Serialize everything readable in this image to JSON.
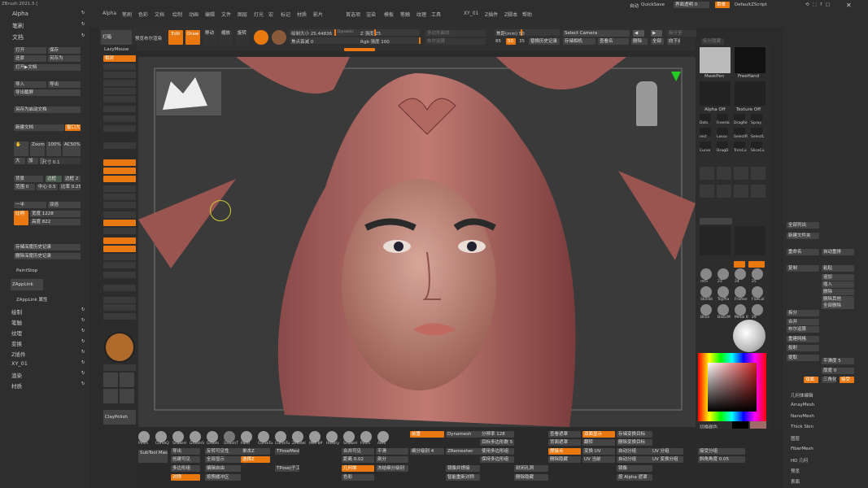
{
  "app": {
    "title": "ZBrush 2021.5 ["
  },
  "menu": [
    "Alpha",
    "笔刷",
    "色彩",
    "文档",
    "绘制",
    "动画",
    "编辑",
    "文件",
    "图层",
    "灯光",
    "宏",
    "标记",
    "材质",
    "影片",
    "首选项",
    "渲染",
    "模板",
    "笔触",
    "纹理",
    "工具",
    "XY_01",
    "Z插件",
    "Z脚本",
    "帮助"
  ],
  "topright": {
    "autosave": "自动",
    "quicksave": "QuickSave",
    "ui_trans": "界面透明 0",
    "menus": "菜单",
    "script": "DefaultZScript"
  },
  "leftpanel": {
    "items": [
      "Alpha",
      "笔刷",
      "文档"
    ],
    "doc_buttons": [
      "打开",
      "保存",
      "还原",
      "另存为",
      "打开▶文档",
      "导入",
      "导出",
      "导出截屏",
      "另存为启动文档"
    ],
    "new_doc": "新建文档",
    "window": "窗口大",
    "zoom": "Zoom2D",
    "pct100": "100%",
    "aahalf": "AC50%",
    "big": "大",
    "add": "加",
    "size_val": "尺寸 0.1",
    "bg": "背景",
    "margin": "边框",
    "border2": "边框 2",
    "range": "范围 0",
    "center": "中心 0.5",
    "ratio": "比率 0.25",
    "half": "一半",
    "double": "双倍",
    "width_lbl": "宽度 1228",
    "height_lbl": "高度 822",
    "ratio_btn": "比例",
    "save_depth": "存储深度历史记录",
    "del_depth": "删除深度历史记录",
    "paintstop": "PaintStop",
    "zapplink": "ZAppLink",
    "zapplink_prop": "ZAppLink 属性",
    "tree": [
      "绘制",
      "笔触",
      "纹理",
      "变换",
      "Z插件",
      "XY_01",
      "渲染",
      "材质"
    ]
  },
  "toolbar": {
    "edit": "Edit",
    "draw": "Draw",
    "move": "移动",
    "scale": "缩放",
    "rotate": "旋转",
    "focal_size": "绘制大小 25.44836",
    "dynamic": "Dynamic",
    "focal_shift": "焦点衰减 0",
    "z_intensity": "Z 强度 25",
    "rgb_intensity": "Rgb 强度 100",
    "select_camera": "Select Camera",
    "store": "存储相机",
    "pick": "查看名",
    "delete": "删除",
    "all": "全部",
    "replace_history": "替换历史记录",
    "cam_mm": "焦距(mm) 50",
    "v85": "85",
    "v50": "50",
    "v35": "35",
    "lazy": "LazyMouse",
    "zadd": "相对",
    "subtool_name": "预览布尔渲染",
    "sub_all": "布尔合并"
  },
  "canvas": {
    "bg": "#3b3b3b"
  },
  "rightlower": {
    "maskpen": "MaskPen",
    "freehand": "FreeHand",
    "alpha_off": "Alpha Off",
    "texture_off": "Texture Off",
    "brushes": [
      "Dots",
      "FreeHa",
      "DragRe",
      "Spray",
      "rect",
      "Lasso",
      "SelectR",
      "SelectL",
      "Curve",
      "DragD",
      "TrimCu",
      "SliceCu"
    ],
    "mats": [
      "mt5",
      "23",
      "24",
      "25",
      "SkinSh",
      "ToyPla",
      "Framer",
      "FlatCol",
      "Blinn",
      "BasicM",
      "Metal 0",
      "29"
    ],
    "switch_color": "切换颜色",
    "main_color": "主色",
    "sec_color": "辅色"
  },
  "rightpanel": {
    "items": [
      "全部列出",
      "新建文件夹",
      "重命名",
      "自动重排",
      "复制",
      "粘贴",
      "追加",
      "插入",
      "删除",
      "删除其他",
      "全部删除",
      "拆分",
      "合并",
      "布尔运算",
      "重建网格",
      "投射",
      "提取"
    ],
    "geometry": [
      "几何体编辑",
      "ArrayMesh",
      "NanoMesh",
      "Thick Skin",
      "图层",
      "FiberMesh",
      "HD 几何",
      "预览",
      "表面"
    ],
    "smooth": "平滑度 5",
    "thickness": "厚度 0",
    "double": "双面",
    "triangulate": "三角化",
    "accept": "接受"
  },
  "bottom": {
    "brushes": [
      "Pinch",
      "CurveQ",
      "SnakeH",
      "GroomS",
      "Groom",
      "GroomT",
      "Paint",
      "CurveTu",
      "CurveTu",
      "ZModel",
      "IMM BP",
      "History",
      "SnakeH",
      "Pinch",
      "Aero"
    ],
    "subtool": "SubTool Master",
    "dynamesh": "Dynamesh",
    "zremesher": "ZRemesher",
    "divide": "分辨率 128",
    "projection": "投影",
    "polish": "抛光",
    "smooth_lbl": "平滑",
    "sdiv": "细分级别 4",
    "del_lower": "删除低级",
    "edges": "边缘",
    "frame": "框架",
    "draw_poly": "绘制多边形",
    "tpose": "TPoseMesh",
    "tpose2": "TPose|子工具",
    "mirror": "对称",
    "merge_visible": "合并可见",
    "delete_hidden": "删除隐藏",
    "clay_polish": "ClayPolish"
  }
}
